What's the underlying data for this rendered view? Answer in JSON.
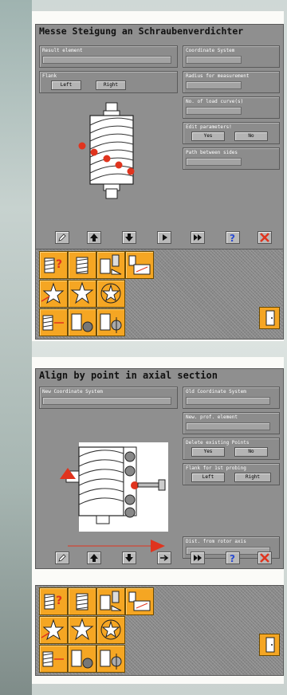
{
  "colors": {
    "accent": "#f5a623",
    "marker": "#e0341e",
    "panel": "#8f8f8f"
  },
  "window1": {
    "title": "Messe Steigung an Schraubenverdichter",
    "result_element_label": "Result element",
    "coordinate_system_label": "Coordinate System",
    "flank_label": "Flank",
    "flank_left": "Left",
    "flank_right": "Right",
    "radius_label": "Radius for measurement",
    "no_load_curves_label": "No. of load curve(s)",
    "edit_parameters_label": "Edit parameters!",
    "edit_yes": "Yes",
    "edit_no": "No",
    "path_between_sides_label": "Path between sides"
  },
  "window2": {
    "title": "Align by point in axial section",
    "new_coordinate_system_label": "New Coordinate System",
    "old_coordinate_system_label": "Old Coordinate System",
    "new_prof_element_label": "New. prof. element",
    "delete_existing_points_label": "Delete existing Points",
    "delete_yes": "Yes",
    "delete_no": "No",
    "flank_first_probing_label": "Flank for 1st probing",
    "flank_left": "Left",
    "flank_right": "Right",
    "dist_from_rotor_axis_label": "Dist. from rotor axis"
  },
  "toolbar_icons": [
    "pencil-icon",
    "arrow-up-icon",
    "arrow-down-icon",
    "arrow-right-icon",
    "fast-forward-icon",
    "help-icon",
    "close-icon"
  ],
  "palette_icons": [
    "rotor-query-icon",
    "rotor-measure-icon",
    "rotor-probe-icon",
    "rotor-profile-icon",
    "star-rotor-arrow-icon",
    "star-rotor-icon",
    "star-rotor-circle-icon",
    "rotor-align-icon",
    "rotor-align-ball-icon",
    "rotor-align-point-icon",
    "exit-door-icon"
  ]
}
